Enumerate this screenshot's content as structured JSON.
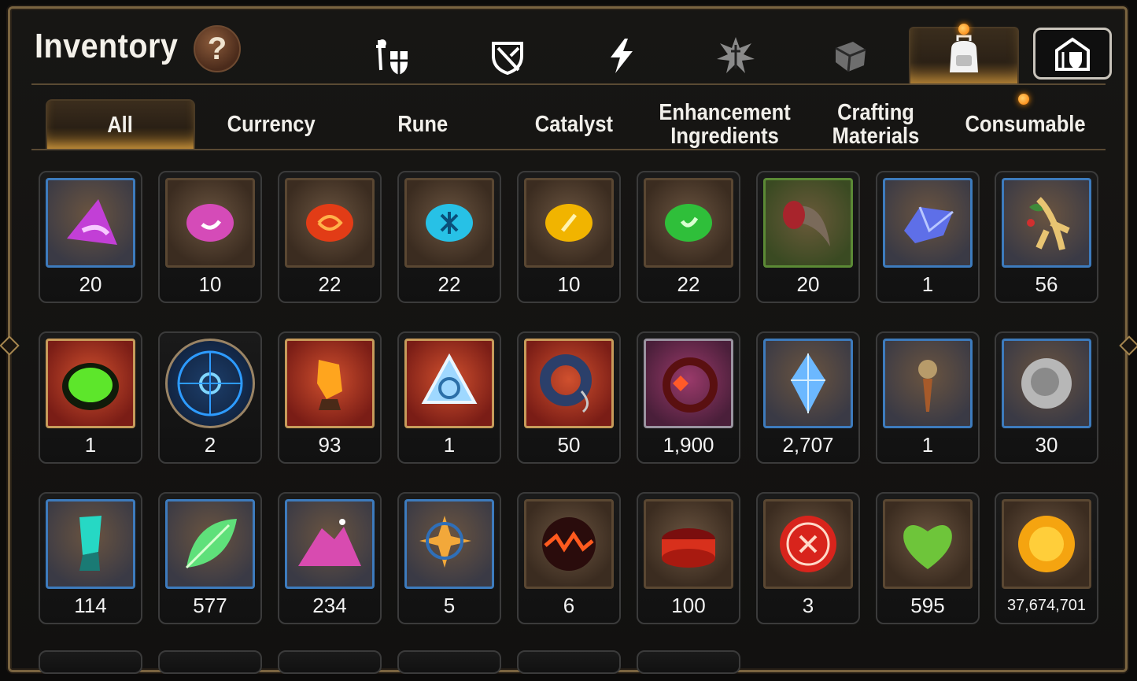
{
  "header": {
    "title": "Inventory",
    "help_symbol": "?"
  },
  "top_tabs": [
    {
      "icon": "knight-shield-icon",
      "active": false
    },
    {
      "icon": "broken-shield-icon",
      "active": false
    },
    {
      "icon": "lightning-icon",
      "active": false
    },
    {
      "icon": "splash-sword-icon",
      "active": false
    },
    {
      "icon": "cube-icon",
      "active": false
    },
    {
      "icon": "backpack-icon",
      "active": true,
      "notification": true
    },
    {
      "icon": "castle-shield-icon",
      "active": false
    }
  ],
  "sub_tabs": [
    {
      "label": "All",
      "active": true
    },
    {
      "label": "Currency"
    },
    {
      "label": "Rune"
    },
    {
      "label": "Catalyst"
    },
    {
      "label": "Enhancement Ingredients"
    },
    {
      "label": "Crafting Materials"
    },
    {
      "label": "Consumable",
      "notification": true
    }
  ],
  "items": [
    {
      "icon": "purple-triangle-gem-icon",
      "count": "20"
    },
    {
      "icon": "pink-rune-stone-icon",
      "count": "10"
    },
    {
      "icon": "red-rune-stone-icon",
      "count": "22"
    },
    {
      "icon": "cyan-rune-stone-icon",
      "count": "22"
    },
    {
      "icon": "yellow-rune-stone-icon",
      "count": "10"
    },
    {
      "icon": "green-rune-stone-icon",
      "count": "22"
    },
    {
      "icon": "claw-icon",
      "count": "20"
    },
    {
      "icon": "blue-crystal-icon",
      "count": "1"
    },
    {
      "icon": "ginseng-root-icon",
      "count": "56"
    },
    {
      "icon": "green-cauldron-icon",
      "count": "1"
    },
    {
      "icon": "blue-magic-circle-icon",
      "count": "2"
    },
    {
      "icon": "orange-crystal-shard-icon",
      "count": "93"
    },
    {
      "icon": "blue-triangle-crystal-icon",
      "count": "1"
    },
    {
      "icon": "pendant-ring-icon",
      "count": "50"
    },
    {
      "icon": "red-flower-ring-icon",
      "count": "1,900"
    },
    {
      "icon": "blue-diamond-icon",
      "count": "2,707"
    },
    {
      "icon": "sword-charm-icon",
      "count": "1"
    },
    {
      "icon": "silver-coin-icon",
      "count": "30"
    },
    {
      "icon": "teal-crystal-icon",
      "count": "114"
    },
    {
      "icon": "green-leaf-icon",
      "count": "577"
    },
    {
      "icon": "pink-ore-pile-icon",
      "count": "234"
    },
    {
      "icon": "star-pendant-icon",
      "count": "5"
    },
    {
      "icon": "lava-orb-icon",
      "count": "6"
    },
    {
      "icon": "red-bracelet-icon",
      "count": "100"
    },
    {
      "icon": "red-seal-icon",
      "count": "3"
    },
    {
      "icon": "green-heart-icon",
      "count": "595"
    },
    {
      "icon": "gold-coin-icon",
      "count": "37,674,701"
    }
  ],
  "colors": {
    "frame_gold": "#7a6440",
    "accent_orange": "#ff8c00",
    "slot_border_blue": "#3d7bbd"
  }
}
